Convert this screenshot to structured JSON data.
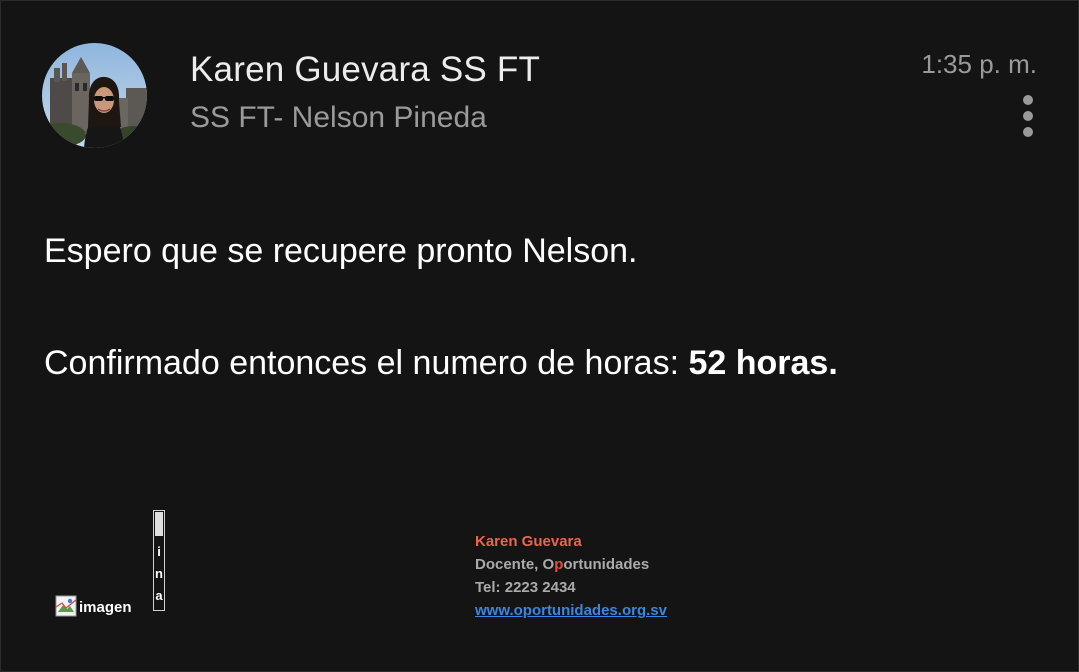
{
  "email": {
    "sender_name": "Karen Guevara SS FT",
    "recipient_line": "SS FT- Nelson Pineda",
    "timestamp": "1:35 p. m.",
    "body_line1": "Espero que se recupere pronto Nelson.",
    "body_line2_prefix": "Confirmado entonces el numero de horas: ",
    "body_line2_bold": "52 horas."
  },
  "signature": {
    "broken_image_alt": "imagen",
    "vertical_alt_text": "i\nn\na",
    "name": "Karen Guevara",
    "role_part1": "Docente, O",
    "role_highlight": "p",
    "role_part2": "ortunidades",
    "tel": "Tel: 2223 2434",
    "website": "www.oportunidades.org.sv"
  },
  "icons": {
    "avatar": "profile-photo",
    "more": "more-vert-icon",
    "broken_image": "broken-image-icon"
  },
  "colors": {
    "background": "#141414",
    "signature_name": "#e8664c",
    "signature_highlight": "#e84c3c",
    "link": "#3a86e0"
  }
}
